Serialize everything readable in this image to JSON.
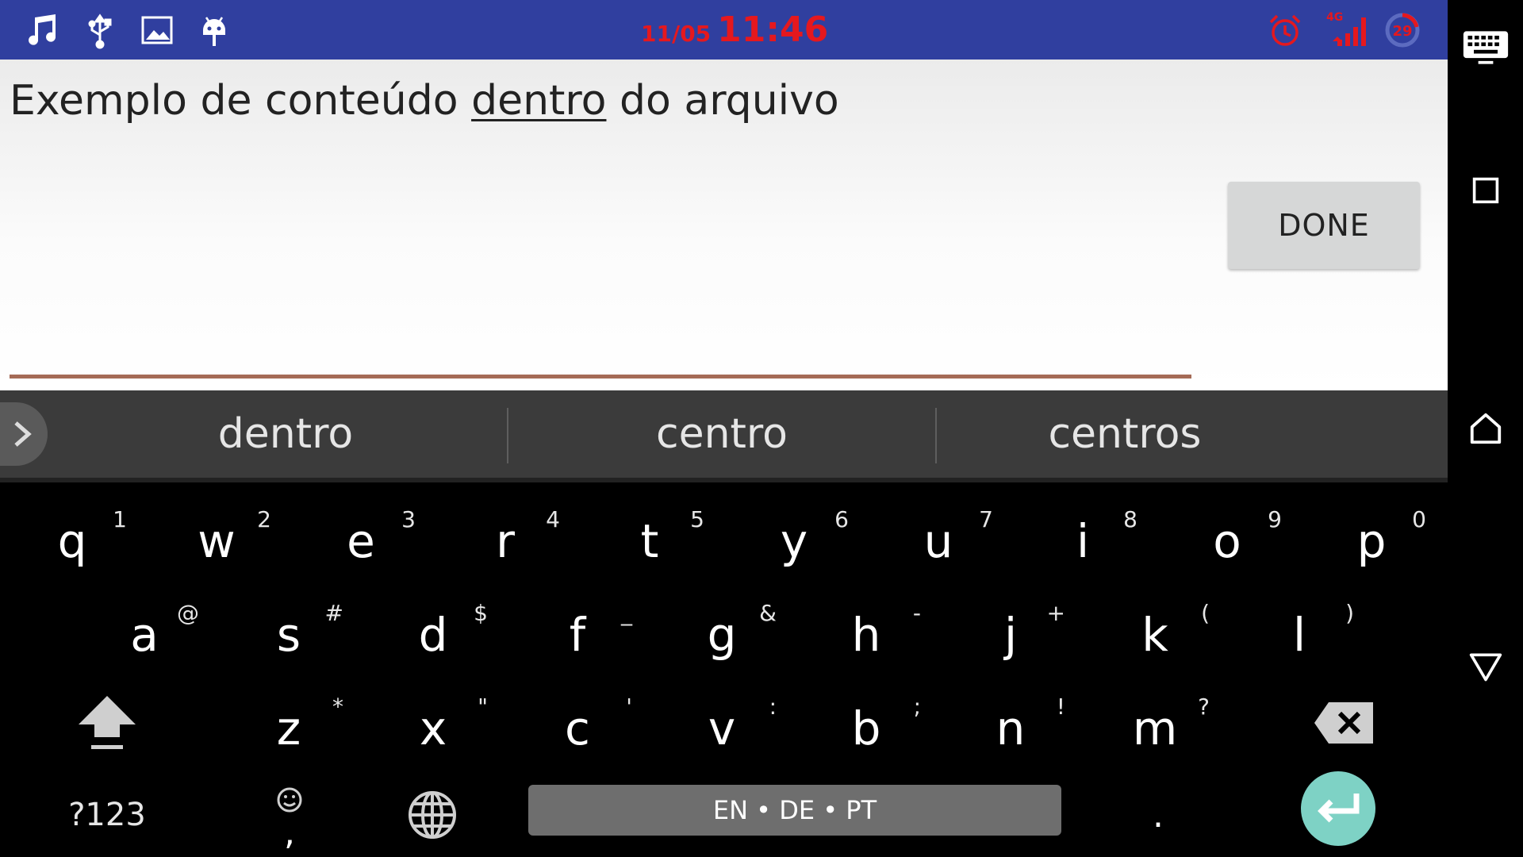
{
  "status_bar": {
    "icons": [
      "music-note-icon",
      "usb-icon",
      "image-icon",
      "android-icon",
      "alarm-icon",
      "signal-4g-icon",
      "battery-icon"
    ],
    "date": "11/05",
    "time": "11:46",
    "network_label": "4G",
    "battery_level": "29",
    "colors": {
      "background": "#303f9f",
      "clock": "#e5181e"
    }
  },
  "editor": {
    "text_before": "Exemplo de conteúdo ",
    "text_underlined": "dentro",
    "text_after": " do arquivo",
    "done_label": "DONE",
    "underline_color": "#a56b57"
  },
  "suggestions": {
    "expand_icon": "chevron-right-icon",
    "items": [
      "dentro",
      "centro",
      "centros"
    ]
  },
  "keyboard": {
    "row1": [
      {
        "key": "q",
        "hint": "1"
      },
      {
        "key": "w",
        "hint": "2"
      },
      {
        "key": "e",
        "hint": "3"
      },
      {
        "key": "r",
        "hint": "4"
      },
      {
        "key": "t",
        "hint": "5"
      },
      {
        "key": "y",
        "hint": "6"
      },
      {
        "key": "u",
        "hint": "7"
      },
      {
        "key": "i",
        "hint": "8"
      },
      {
        "key": "o",
        "hint": "9"
      },
      {
        "key": "p",
        "hint": "0"
      }
    ],
    "row2": [
      {
        "key": "a",
        "hint": "@"
      },
      {
        "key": "s",
        "hint": "#"
      },
      {
        "key": "d",
        "hint": "$"
      },
      {
        "key": "f",
        "hint": "_"
      },
      {
        "key": "g",
        "hint": "&"
      },
      {
        "key": "h",
        "hint": "-"
      },
      {
        "key": "j",
        "hint": "+"
      },
      {
        "key": "k",
        "hint": "("
      },
      {
        "key": "l",
        "hint": ")"
      }
    ],
    "row3": [
      {
        "key": "z",
        "hint": "*"
      },
      {
        "key": "x",
        "hint": "\""
      },
      {
        "key": "c",
        "hint": "'"
      },
      {
        "key": "v",
        "hint": ":"
      },
      {
        "key": "b",
        "hint": ";"
      },
      {
        "key": "n",
        "hint": "!"
      },
      {
        "key": "m",
        "hint": "?"
      }
    ],
    "shift_icon": "shift-arrow-icon",
    "backspace_icon": "backspace-icon",
    "symbols_label": "?123",
    "comma_key": ",",
    "emoji_icon": "smiley-icon",
    "globe_icon": "globe-icon",
    "space_label": "EN • DE • PT",
    "period_key": ".",
    "enter_icon": "return-arrow-icon",
    "enter_color": "#7ed2c5"
  },
  "nav_bar": {
    "icons": [
      "keyboard-icon",
      "recents-square-icon",
      "home-icon",
      "back-triangle-icon"
    ]
  }
}
